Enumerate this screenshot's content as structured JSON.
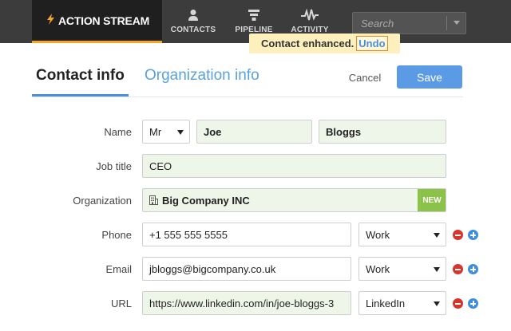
{
  "header": {
    "brand": "ACTION STREAM",
    "nav": [
      {
        "label": "CONTACTS",
        "icon": "person-icon"
      },
      {
        "label": "PIPELINE",
        "icon": "funnel-icon"
      },
      {
        "label": "ACTIVITY",
        "icon": "pulse-icon"
      }
    ],
    "search": {
      "placeholder": "Search",
      "value": ""
    }
  },
  "toast": {
    "message": "Contact enhanced.",
    "action": "Undo"
  },
  "tabs": [
    {
      "label": "Contact info",
      "active": true
    },
    {
      "label": "Organization info",
      "active": false
    }
  ],
  "actions": {
    "cancel_label": "Cancel",
    "save_label": "Save"
  },
  "form": {
    "name": {
      "label": "Name",
      "salutation": "Mr",
      "first": "Joe",
      "last": "Bloggs"
    },
    "job_title": {
      "label": "Job title",
      "value": "CEO"
    },
    "organization": {
      "label": "Organization",
      "value": "Big Company INC",
      "badge": "NEW"
    },
    "phone": {
      "label": "Phone",
      "value": "+1 555 555 5555",
      "type": "Work"
    },
    "email": {
      "label": "Email",
      "value": "jbloggs@bigcompany.co.uk",
      "type": "Work"
    },
    "url": {
      "label": "URL",
      "value": "https://www.linkedin.com/in/joe-bloggs-3",
      "type": "LinkedIn"
    }
  },
  "colors": {
    "topbar": "#3c3c3c",
    "brand_accent": "#f5a623",
    "link_blue": "#4a90d9",
    "save_button": "#5b9be6",
    "enhanced_field": "#eef6ea",
    "new_badge": "#8bc34a",
    "remove": "#d9342b",
    "add": "#3d8ee0",
    "toast_bg": "#fdf0bd"
  }
}
